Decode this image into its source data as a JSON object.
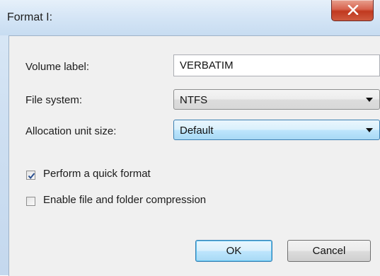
{
  "window": {
    "title": "Format I:",
    "close_icon": "close-icon"
  },
  "form": {
    "volume_label": {
      "label": "Volume label:",
      "value": "VERBATIM"
    },
    "file_system": {
      "label": "File system:",
      "value": "NTFS"
    },
    "allocation_unit": {
      "label": "Allocation unit size:",
      "value": "Default"
    }
  },
  "options": {
    "quick_format": {
      "label": "Perform a quick format",
      "checked": true
    },
    "compression": {
      "label": "Enable file and folder compression",
      "checked": false
    }
  },
  "buttons": {
    "ok": "OK",
    "cancel": "Cancel"
  }
}
